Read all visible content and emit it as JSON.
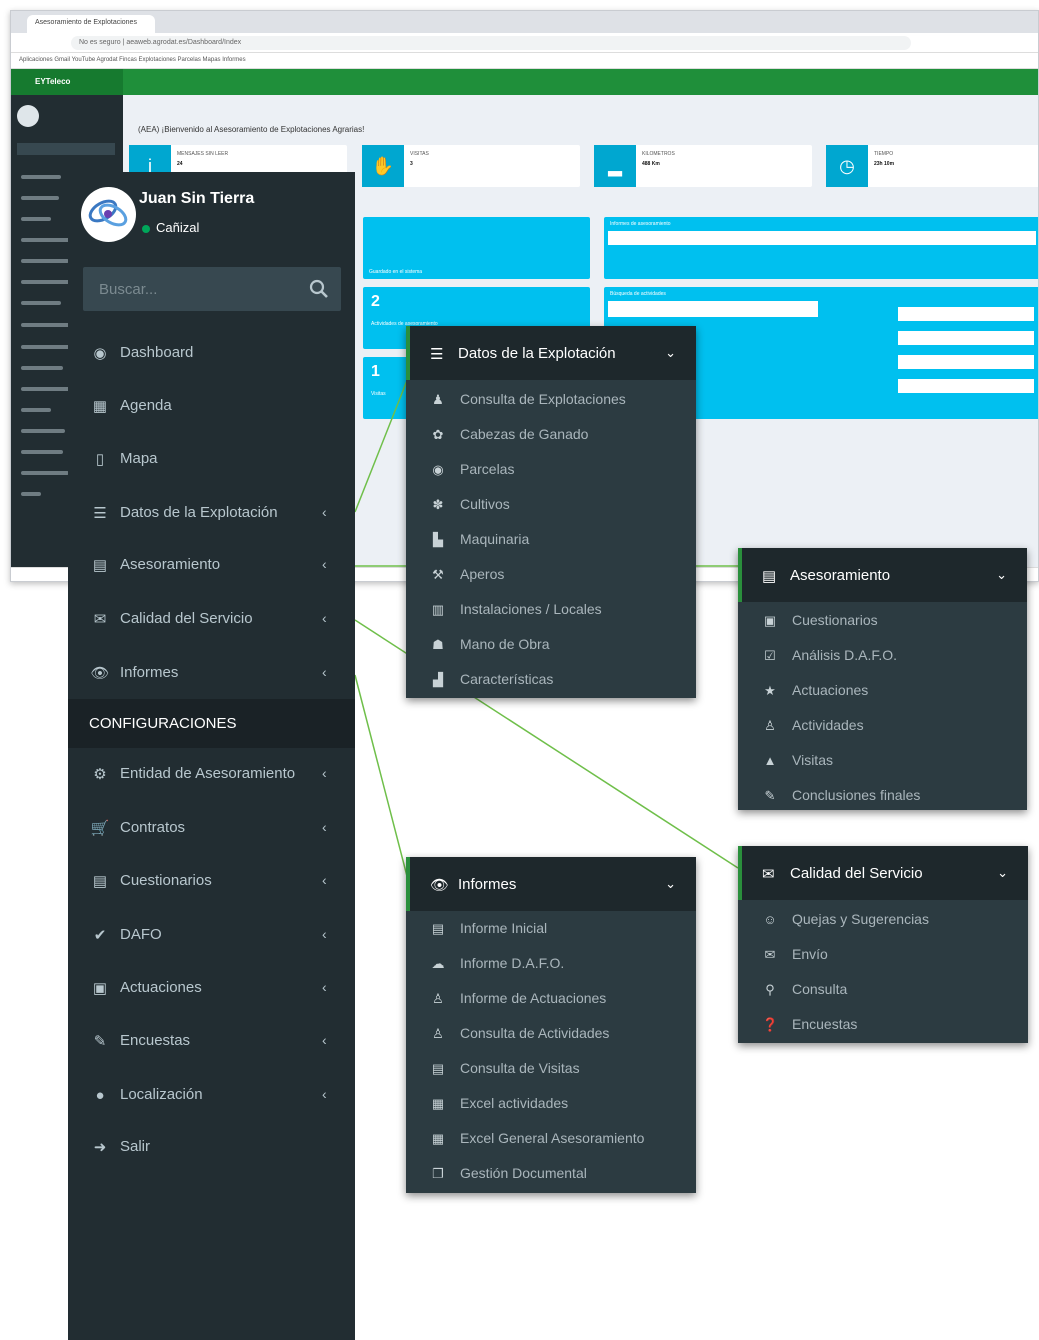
{
  "background": {
    "tab_title": "Asesoramiento de Explotaciones",
    "address": "No es seguro | aeaweb.agrodat.es/Dashboard/Index",
    "bookmarks": "Aplicaciones  Gmail  YouTube  Agrodat  Fincas  Explotaciones  Parcelas  Mapas  Informes",
    "app_logo": "EYTeleco",
    "page_title": "(AEA) ¡Bienvenido al Asesoramiento de Explotaciones Agrarias!",
    "info_boxes": [
      {
        "icon": "info-icon",
        "label": "MENSAJES SIN LEER",
        "value": "24"
      },
      {
        "icon": "thumb-icon",
        "label": "VISITAS",
        "value": "3"
      },
      {
        "icon": "car-icon",
        "label": "KILOMETROS",
        "value": "488 Km"
      },
      {
        "icon": "clock-icon",
        "label": "TIEMPO",
        "value": "23h 10m"
      }
    ],
    "tiles": [
      {
        "num": "",
        "sub": "Guardado en el sistema"
      },
      {
        "num": "2",
        "sub": "Actividades de asesoramiento"
      },
      {
        "num": "1",
        "sub": "Visitas"
      }
    ],
    "panels": [
      "Informes de asesoramiento",
      "Búsqueda de actividades"
    ]
  },
  "sidebar": {
    "user_name": "Juan Sin Tierra",
    "user_status": "Cañizal",
    "search_placeholder": "Buscar...",
    "items": [
      {
        "name": "nav-dashboard",
        "icon": "tachometer-icon",
        "glyph": "◉",
        "label": "Dashboard",
        "chevron": false
      },
      {
        "name": "nav-agenda",
        "icon": "calendar-icon",
        "glyph": "▦",
        "label": "Agenda",
        "chevron": false
      },
      {
        "name": "nav-mapa",
        "icon": "map-icon",
        "glyph": "▯",
        "label": "Mapa",
        "chevron": false
      },
      {
        "name": "nav-datos-explotacion",
        "icon": "list-icon",
        "glyph": "☰",
        "label": "Datos de la Explotación",
        "chevron": true
      },
      {
        "name": "nav-asesoramiento",
        "icon": "newspaper-icon",
        "glyph": "▤",
        "label": "Asesoramiento",
        "chevron": true
      },
      {
        "name": "nav-calidad-servicio",
        "icon": "envelope-open-icon",
        "glyph": "✉",
        "label": "Calidad del Servicio",
        "chevron": true
      },
      {
        "name": "nav-informes",
        "icon": "eye-icon",
        "glyph": "👁",
        "label": "Informes",
        "chevron": true
      }
    ],
    "config_header": "CONFIGURACIONES",
    "config_items": [
      {
        "name": "nav-entidad",
        "icon": "cogs-icon",
        "glyph": "⚙",
        "label": "Entidad de Asesoramiento",
        "chevron": true
      },
      {
        "name": "nav-contratos",
        "icon": "cart-icon",
        "glyph": "🛒",
        "label": "Contratos",
        "chevron": true
      },
      {
        "name": "nav-cuestionarios",
        "icon": "list-alt-icon",
        "glyph": "▤",
        "label": "Cuestionarios",
        "chevron": true
      },
      {
        "name": "nav-dafo",
        "icon": "check-icon",
        "glyph": "✔",
        "label": "DAFO",
        "chevron": true
      },
      {
        "name": "nav-actuaciones",
        "icon": "clipboard-icon",
        "glyph": "▣",
        "label": "Actuaciones",
        "chevron": true
      },
      {
        "name": "nav-encuestas",
        "icon": "edit-icon",
        "glyph": "✎",
        "label": "Encuestas",
        "chevron": true
      },
      {
        "name": "nav-localizacion",
        "icon": "globe-icon",
        "glyph": "●",
        "label": "Localización",
        "chevron": true
      },
      {
        "name": "nav-salir",
        "icon": "sign-out-icon",
        "glyph": "➜",
        "label": "Salir",
        "chevron": false
      }
    ],
    "chevron_glyph": "‹"
  },
  "popups": {
    "datos": {
      "title": "Datos de la Explotación",
      "icon_glyph": "☰",
      "items": [
        {
          "icon": "user-icon",
          "glyph": "♟",
          "label": "Consulta de Explotaciones"
        },
        {
          "icon": "paw-icon",
          "glyph": "✿",
          "label": "Cabezas de Ganado"
        },
        {
          "icon": "eye-icon",
          "glyph": "◉",
          "label": "Parcelas"
        },
        {
          "icon": "leaf-icon",
          "glyph": "✽",
          "label": "Cultivos"
        },
        {
          "icon": "truck-icon",
          "glyph": "▙",
          "label": "Maquinaria"
        },
        {
          "icon": "gavel-icon",
          "glyph": "⚒",
          "label": "Aperos"
        },
        {
          "icon": "building-icon",
          "glyph": "▥",
          "label": "Instalaciones / Locales"
        },
        {
          "icon": "users-icon",
          "glyph": "☗",
          "label": "Mano de Obra"
        },
        {
          "icon": "bar-chart-icon",
          "glyph": "▟",
          "label": "Características"
        }
      ]
    },
    "asesoramiento": {
      "title": "Asesoramiento",
      "icon_glyph": "▤",
      "items": [
        {
          "icon": "clipboard-icon",
          "glyph": "▣",
          "label": "Cuestionarios"
        },
        {
          "icon": "check-square-icon",
          "glyph": "☑",
          "label": "Análisis D.A.F.O."
        },
        {
          "icon": "star-icon",
          "glyph": "★",
          "label": "Actuaciones"
        },
        {
          "icon": "walking-icon",
          "glyph": "♙",
          "label": "Actividades"
        },
        {
          "icon": "car-icon",
          "glyph": "▲",
          "label": "Visitas"
        },
        {
          "icon": "edit-icon",
          "glyph": "✎",
          "label": "Conclusiones finales"
        }
      ]
    },
    "informes": {
      "title": "Informes",
      "icon_glyph": "👁",
      "items": [
        {
          "icon": "list-alt-icon",
          "glyph": "▤",
          "label": "Informe Inicial"
        },
        {
          "icon": "cloud-icon",
          "glyph": "☁",
          "label": "Informe D.A.F.O."
        },
        {
          "icon": "thumbs-up-icon",
          "glyph": "♙",
          "label": "Informe de Actuaciones"
        },
        {
          "icon": "walking-icon",
          "glyph": "♙",
          "label": "Consulta de Actividades"
        },
        {
          "icon": "list-alt-icon",
          "glyph": "▤",
          "label": "Consulta de Visitas"
        },
        {
          "icon": "file-excel-icon",
          "glyph": "▦",
          "label": "Excel actividades"
        },
        {
          "icon": "file-excel-icon",
          "glyph": "▦",
          "label": "Excel General Asesoramiento"
        },
        {
          "icon": "copy-icon",
          "glyph": "❐",
          "label": "Gestión Documental"
        }
      ]
    },
    "calidad": {
      "title": "Calidad del Servicio",
      "icon_glyph": "✉",
      "items": [
        {
          "icon": "comments-icon",
          "glyph": "☺",
          "label": "Quejas y Sugerencias"
        },
        {
          "icon": "envelope-icon",
          "glyph": "✉",
          "label": "Envío"
        },
        {
          "icon": "search-icon",
          "glyph": "⚲",
          "label": "Consulta"
        },
        {
          "icon": "question-icon",
          "glyph": "❓",
          "label": "Encuestas"
        }
      ]
    },
    "chevron_glyph": "⌄"
  },
  "colors": {
    "sidebar_bg": "#222d32",
    "popup_bg": "#2c3b41",
    "header_bg": "#1e282c",
    "accent_green": "#1f8f3a",
    "info_blue": "#00c0ef",
    "connector": "#6fbf4a"
  }
}
